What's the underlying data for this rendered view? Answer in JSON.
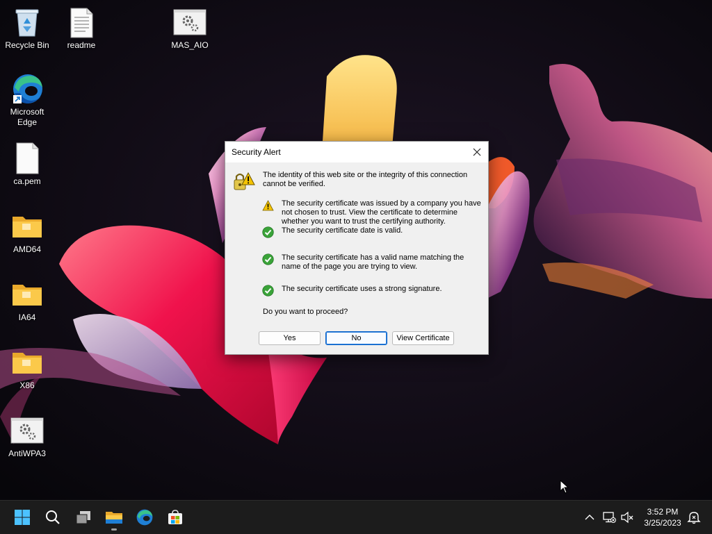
{
  "desktop": {
    "icons": [
      {
        "label": "Recycle Bin",
        "icon": "recycle-bin-icon"
      },
      {
        "label": "readme",
        "icon": "text-file-icon"
      },
      {
        "label": "MAS_AIO",
        "icon": "settings-script-icon"
      },
      {
        "label": "Microsoft Edge",
        "icon": "edge-icon"
      },
      {
        "label": "ca.pem",
        "icon": "file-icon"
      },
      {
        "label": "AMD64",
        "icon": "folder-icon"
      },
      {
        "label": "IA64",
        "icon": "folder-icon"
      },
      {
        "label": "X86",
        "icon": "folder-icon"
      },
      {
        "label": "AntiWPA3",
        "icon": "settings-script-icon"
      }
    ]
  },
  "dialog": {
    "title": "Security Alert",
    "intro": "The identity of this web site or the integrity of this connection cannot be verified.",
    "items": [
      {
        "status": "warning",
        "text": "The security certificate was issued by a company you have not chosen to trust. View the certificate to determine whether you want to trust the certifying authority."
      },
      {
        "status": "ok",
        "text": "The security certificate date is valid."
      },
      {
        "status": "ok",
        "text": "The security certificate has a valid name matching the name of the page you are trying to view."
      },
      {
        "status": "ok",
        "text": "The security certificate uses a strong signature."
      }
    ],
    "question": "Do you want to proceed?",
    "buttons": {
      "yes": "Yes",
      "no": "No",
      "view_certificate": "View Certificate"
    },
    "default_button": "no"
  },
  "taskbar": {
    "apps": [
      "start-icon",
      "search-icon",
      "task-view-icon",
      "file-explorer-icon",
      "edge-icon",
      "store-icon"
    ],
    "active_app": "file-explorer-icon",
    "tray": [
      "chevron-up-icon",
      "network-icon",
      "volume-muted-icon",
      "notification-icon"
    ],
    "clock": {
      "time": "3:52 PM",
      "date": "3/25/2023"
    }
  },
  "colors": {
    "taskbar_bg": "#1c1c1c",
    "dialog_bg": "#f0f0f0",
    "default_button_border": "#0b63c8",
    "warning": "#f5c400",
    "ok": "#3aa339"
  }
}
